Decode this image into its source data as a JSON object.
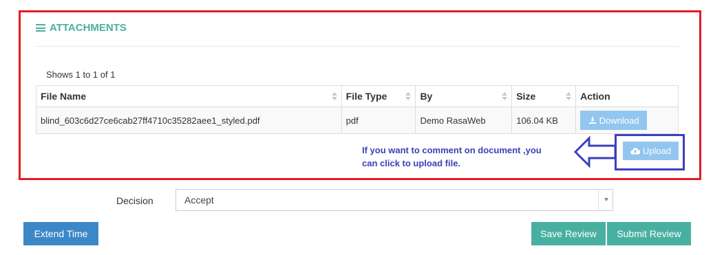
{
  "panel": {
    "title": "ATTACHMENTS",
    "title_icon": "list-icon",
    "shows_text": "Shows 1 to 1 of 1"
  },
  "table": {
    "columns": [
      "File Name",
      "File Type",
      "By",
      "Size",
      "Action"
    ],
    "rows": [
      {
        "file_name": "blind_603c6d27ce6cab27ff4710c35282aee1_styled.pdf",
        "file_type": "pdf",
        "by": "Demo RasaWeb",
        "size": "106.04 KB",
        "action_label": "Download"
      }
    ]
  },
  "upload": {
    "label": "Upload"
  },
  "annotation": {
    "note_line1": "If you want to comment on document ,you",
    "note_line2": "can click to upload file."
  },
  "decision": {
    "label": "Decision",
    "selected": "Accept"
  },
  "buttons": {
    "extend_time": "Extend Time",
    "save_review": "Save Review",
    "submit_review": "Submit Review"
  },
  "colors": {
    "accent_teal": "#48b0a0",
    "primary_blue": "#3c87c8",
    "light_blue": "#93c6ee",
    "annotation_red": "#e31b23",
    "annotation_blue": "#3b3fbf"
  }
}
